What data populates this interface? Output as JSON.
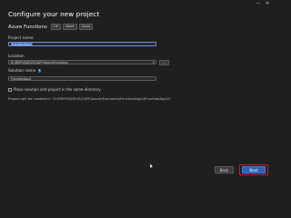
{
  "window": {
    "minimize_glyph": "—",
    "close_glyph": "✕"
  },
  "page": {
    "title": "Configure your new project"
  },
  "template": {
    "name": "Azure Functions",
    "tags": [
      "C#",
      "Azure",
      "Cloud"
    ]
  },
  "form": {
    "project_name": {
      "label": "Project name",
      "value": "FunctionApp1"
    },
    "location": {
      "label": "Location",
      "value": "D:\\REPOS\\DEVSC\\0FF\\Azure\\Functions",
      "browse_label": "..."
    },
    "solution_name": {
      "label": "Solution name",
      "value": "FunctionApp1"
    },
    "same_directory": {
      "label": "Place solution and project in the same directory",
      "checked": false
    },
    "path_note": "Project will be created in \"D:\\REPOS\\DEVSC\\0FF\\Azure\\Functions\\FunctionApp1\\FunctionApp1\\\""
  },
  "footer": {
    "back_label": "Back",
    "next_label": "Next"
  },
  "colors": {
    "background": "#1f1f1f",
    "accent": "#2f5fb8",
    "highlight": "#c0202a"
  },
  "icons": {
    "info": "info-icon",
    "dropdown": "chevron-down-icon",
    "cursor": "mouse-pointer-icon"
  }
}
